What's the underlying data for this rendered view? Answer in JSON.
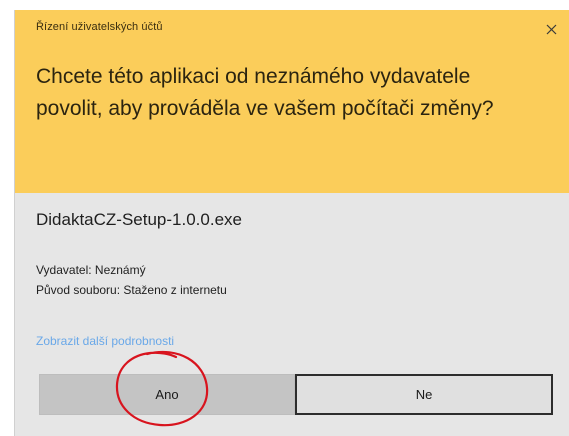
{
  "dialog": {
    "title": "Řízení uživatelských účtů",
    "close_icon": "close-icon",
    "question": "Chcete této aplikaci od neznámého vydavatele povolit, aby prováděla ve vašem počítači změny?",
    "filename": "DidaktaCZ-Setup-1.0.0.exe",
    "publisher": "Vydavatel: Neznámý",
    "origin": "Původ souboru: Staženo z internetu",
    "more_details": "Zobrazit další podrobnosti",
    "yes_label": "Ano",
    "no_label": "Ne"
  },
  "colors": {
    "header": "#fbcd5a",
    "body": "#e6e6e6",
    "link": "#6aa8e8",
    "annotation": "#d8141e"
  }
}
